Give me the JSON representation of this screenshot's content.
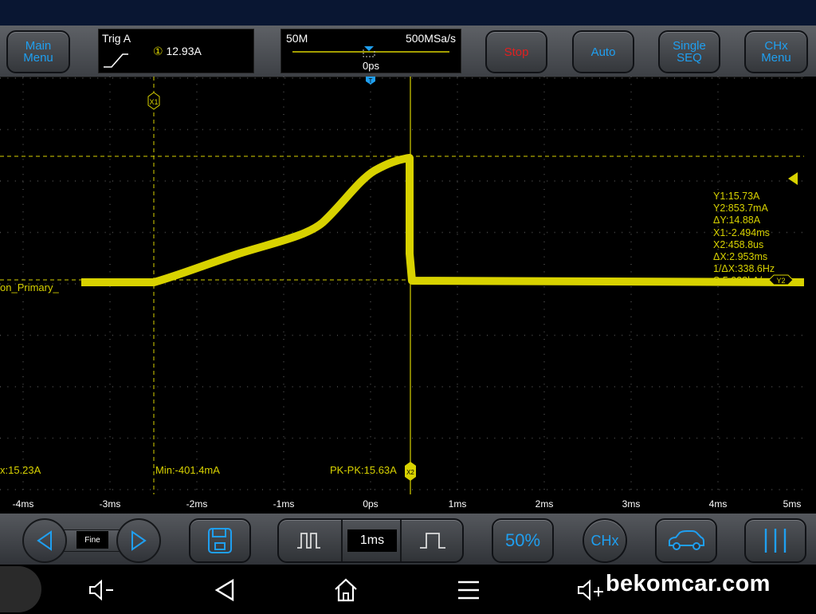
{
  "topbar": {
    "main_menu": [
      "Main",
      "Menu"
    ],
    "trigger": {
      "label": "Trig A",
      "channel_symbol": "①",
      "level": "12.93A"
    },
    "timebase": {
      "memory": "50M",
      "sample_rate": "500MSa/s",
      "position": "0ps"
    },
    "stop_label": "Stop",
    "auto_label": "Auto",
    "single_seq": [
      "Single",
      "SEQ"
    ],
    "chx_menu": [
      "CHx",
      "Menu"
    ]
  },
  "colors": {
    "trace": "#d8d200",
    "accent": "#1f9ff0",
    "stop": "#e02020"
  },
  "screen": {
    "cursor_x1_label": "X1",
    "cursor_x2_label": "X2",
    "cursor_y2_label": "Y2",
    "trigger_marker": "T",
    "channel_label": "on_Primary_",
    "measurements": [
      "Y1:15.73A",
      "Y2:853.7mA",
      "ΔY:14.88A",
      "X1:-2.494ms",
      "X2:458.8us",
      "ΔX:2.953ms",
      "1/ΔX:338.6Hz",
      "S:5.038kA/s"
    ],
    "stats": {
      "max": "x:15.23A",
      "min": "Min:-401.4mA",
      "pkpk": "PK-PK:15.63A"
    }
  },
  "xaxis": {
    "ticks": [
      "-4ms",
      "-3ms",
      "-2ms",
      "-1ms",
      "0ps",
      "1ms",
      "2ms",
      "3ms",
      "4ms",
      "5ms"
    ]
  },
  "bottombar": {
    "fine_label": "Fine",
    "timebase_value": "1ms",
    "percent_label": "50%",
    "chx_label": "CHx"
  },
  "watermark": "bekomcar.com",
  "icons": {
    "nav": [
      "volume-down-icon",
      "back-icon",
      "home-icon",
      "menu-icon",
      "volume-up-icon"
    ],
    "bottom": [
      "arrow-left-icon",
      "arrow-right-icon",
      "save-icon",
      "pulse-narrow-icon",
      "pulse-wide-icon",
      "car-icon",
      "cursor-bars-icon"
    ]
  }
}
